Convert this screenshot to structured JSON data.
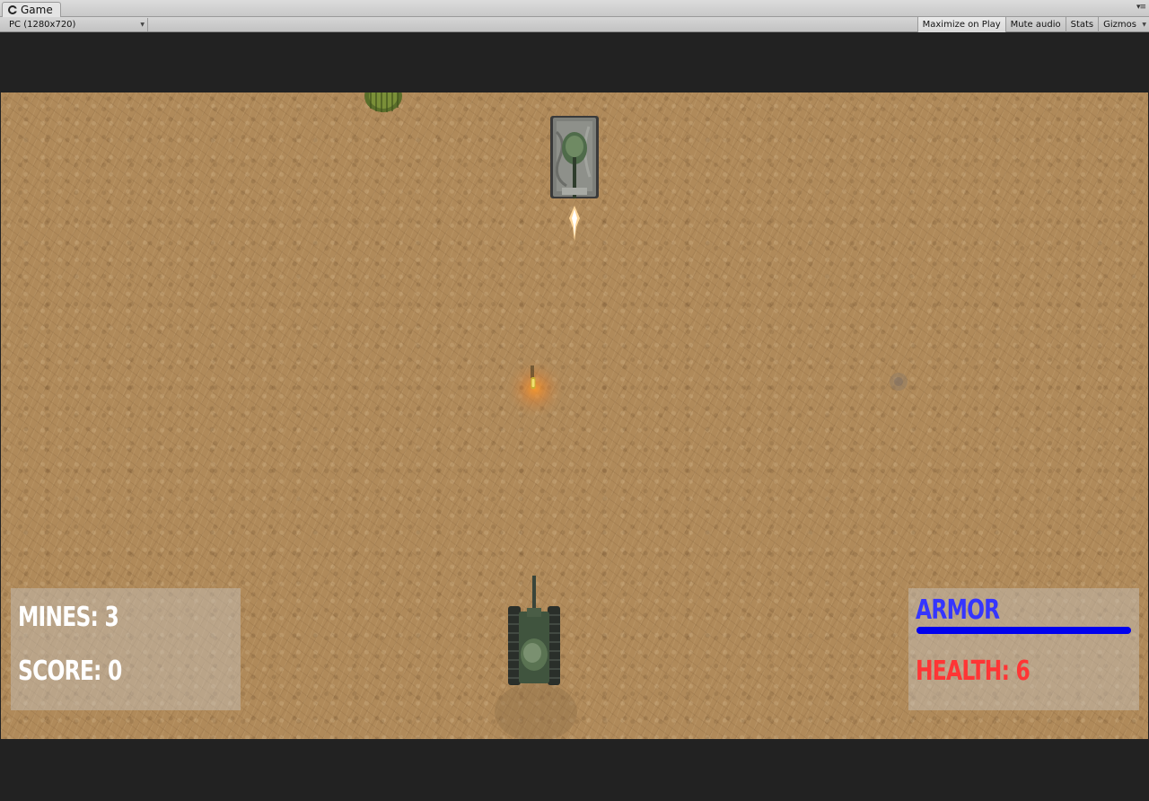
{
  "window": {
    "tab_title": "Game"
  },
  "toolbar": {
    "aspect": "PC (1280x720)",
    "maximize_on_play": "Maximize on Play",
    "mute_audio": "Mute audio",
    "stats": "Stats",
    "gizmos": "Gizmos"
  },
  "hud": {
    "mines": "MINES: 3",
    "score": "SCORE: 0",
    "armor_label": "ARMOR",
    "armor_fraction": 1.0,
    "health": "HEALTH: 6"
  },
  "colors": {
    "armor": "#3535ff",
    "armor_bar": "#0000ee",
    "health": "#ff3535",
    "hud_text": "#ffffff",
    "ground": "#b08a5a"
  },
  "icons": [
    "unity-logo-icon",
    "window-menu-icon",
    "dropdown-arrow-icon"
  ]
}
